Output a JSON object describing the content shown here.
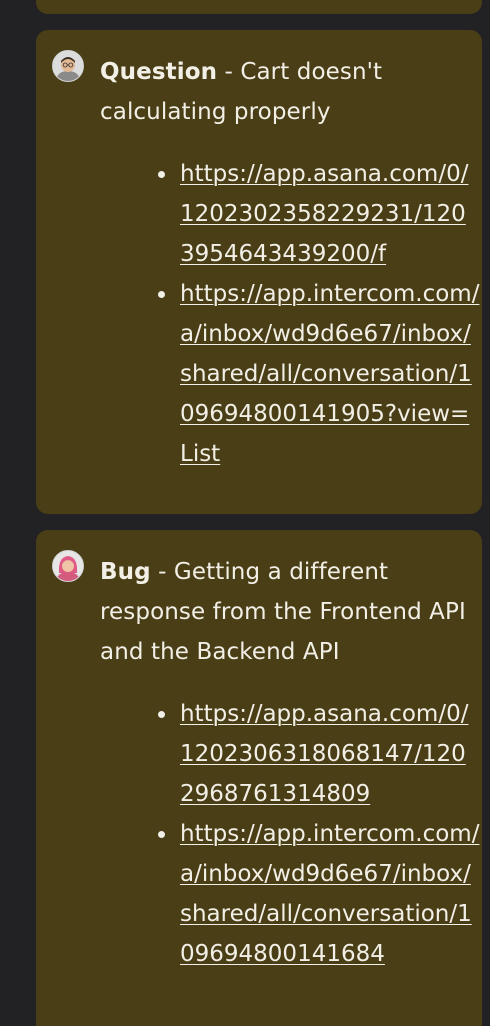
{
  "cards": [
    {
      "kind": "Question",
      "separator": " - ",
      "summary": "Cart doesn't calculating properly",
      "avatar_icon": "user-avatar-man-glasses",
      "links": [
        "https://app.asana.com/0/1202302358229231/1203954643439200/f",
        "https://app.intercom.com/a/inbox/wd9d6e67/inbox/shared/all/conversation/109694800141905?view=List"
      ]
    },
    {
      "kind": "Bug",
      "separator": " - ",
      "summary": "Getting a different response from the Frontend API and the Backend API",
      "avatar_icon": "user-avatar-woman-pink-hair",
      "links": [
        "https://app.asana.com/0/1202306318068147/1202968761314809",
        "https://app.intercom.com/a/inbox/wd9d6e67/inbox/shared/all/conversation/109694800141684"
      ]
    }
  ],
  "colors": {
    "background": "#222224",
    "card": "#4a3e16",
    "text": "#f2efe6"
  }
}
